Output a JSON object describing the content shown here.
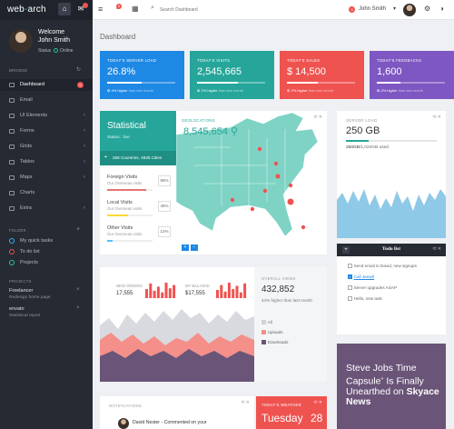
{
  "brand": {
    "text_a": "web",
    "text_b": "arch"
  },
  "sidebar": {
    "welcome": "Welcome",
    "user_name": "John Smith",
    "status_label": "Status",
    "status_value": "Online",
    "browse_heading": "BROWSE",
    "items": [
      {
        "label": "Dashboard",
        "badge": "5"
      },
      {
        "label": "Email"
      },
      {
        "label": "UI Elements"
      },
      {
        "label": "Forms"
      },
      {
        "label": "Grids"
      },
      {
        "label": "Tables"
      },
      {
        "label": "Maps"
      },
      {
        "label": "Charts"
      },
      {
        "label": "Extra"
      }
    ],
    "folder_heading": "FOLDER",
    "folders": [
      {
        "label": "My quick tasks",
        "color": "#29b6f6"
      },
      {
        "label": "To do list",
        "color": "#ef5350"
      },
      {
        "label": "Projects",
        "color": "#26c6a5"
      }
    ],
    "projects_heading": "PROJECTS",
    "projects": [
      {
        "title": "Freelancer",
        "subtitle": "Redesign home page"
      },
      {
        "title": "envato",
        "subtitle": "Statistical report"
      }
    ]
  },
  "topbar": {
    "notification_count": "3",
    "search_placeholder": "Search Dashboard",
    "user_badge": "3",
    "user_name": "John Smith"
  },
  "page": {
    "title": "Dashboard"
  },
  "tiles": [
    {
      "label": "TODAY'S SERVER LOAD",
      "value": "26.8%",
      "progress": 0.5,
      "foot_a": "4% higher",
      "foot_b": "than last month",
      "color": "#1e88e5"
    },
    {
      "label": "TODAY'S VISITS",
      "value": "2,545,665",
      "progress": 0.6,
      "foot_a": "2% higher",
      "foot_b": "than last month",
      "color": "#26a69a"
    },
    {
      "label": "TODAY'S SALES",
      "value": "$ 14,500",
      "progress": 0.45,
      "foot_a": "2% higher",
      "foot_b": "than last month",
      "color": "#ef5350"
    },
    {
      "label": "TODAY'S FEEDBACKS",
      "value": "1,600",
      "progress": 0.35,
      "foot_a": "2% higher",
      "foot_b": "than last month",
      "color": "#7e57c2"
    }
  ],
  "map": {
    "title": "Statistical",
    "subtitle": "Status : live",
    "countries_label": "258 Countries, 4835 Cities",
    "geo_label": "GEOLOCATIONS",
    "geo_value": "8,545,654",
    "stats": [
      {
        "title": "Foreign Visits",
        "sub": "Our Overseas visits",
        "percent": "85%",
        "progress": 0.85,
        "color": "#e57373"
      },
      {
        "title": "Local Visits",
        "sub": "Our Overseas visits",
        "percent": "45%",
        "progress": 0.45,
        "color": "#fdd835"
      },
      {
        "title": "Other Visits",
        "sub": "Our Overseas visits",
        "percent": "12%",
        "progress": 0.12,
        "color": "#4fc3f7"
      }
    ],
    "zoom_in": "+",
    "zoom_out": "−"
  },
  "server_load": {
    "label": "SERVER LOAD",
    "value": "250 GB",
    "used_value": "250GB",
    "used_total": "/1,024GB",
    "used_suffix": "used",
    "progress": 0.25
  },
  "todo": {
    "title": "Todo list",
    "add": "+",
    "items": [
      {
        "text": "Send email to David, new signups",
        "checked": false,
        "link": false
      },
      {
        "text": "Call Jamell",
        "checked": true,
        "link": true
      },
      {
        "text": "Server upgrades ASAP",
        "checked": false,
        "link": false
      },
      {
        "text": "Hello, new task",
        "checked": false,
        "link": false
      }
    ]
  },
  "mini_stats": {
    "new_orders_label": "NEW ORDERS",
    "new_orders_value": "17,555",
    "new_orders_bars": [
      0.55,
      0.9,
      0.45,
      0.7,
      0.35,
      0.95,
      0.6,
      0.8
    ],
    "balance_label": "MY BALANCE",
    "balance_value": "$17,555",
    "balance_bars": [
      0.5,
      0.8,
      0.4,
      0.95,
      0.55,
      0.75,
      0.35,
      0.9
    ]
  },
  "overall_views": {
    "label": "OVERALL VIEWS",
    "value": "432,852",
    "sub": "44% higher than last month",
    "legend": [
      {
        "label": "All",
        "color": "#cfd2d8"
      },
      {
        "label": "Uploads",
        "color": "#f48f8a"
      },
      {
        "label": "Downloads",
        "color": "#6a5478"
      }
    ]
  },
  "notifications": {
    "label": "NOTIFICATIONS",
    "first_item": "David Nester - Commented on your"
  },
  "weather": {
    "label": "TODAY'S WEATHER",
    "day": "Tuesday",
    "temp": "28"
  },
  "quote": {
    "line1": "Steve Jobs",
    "line2": "Time",
    "line3": "Capsule",
    "line4": "Is Finally",
    "line5": "Unearthed on",
    "line6": "Skyace",
    "line7": "News"
  }
}
